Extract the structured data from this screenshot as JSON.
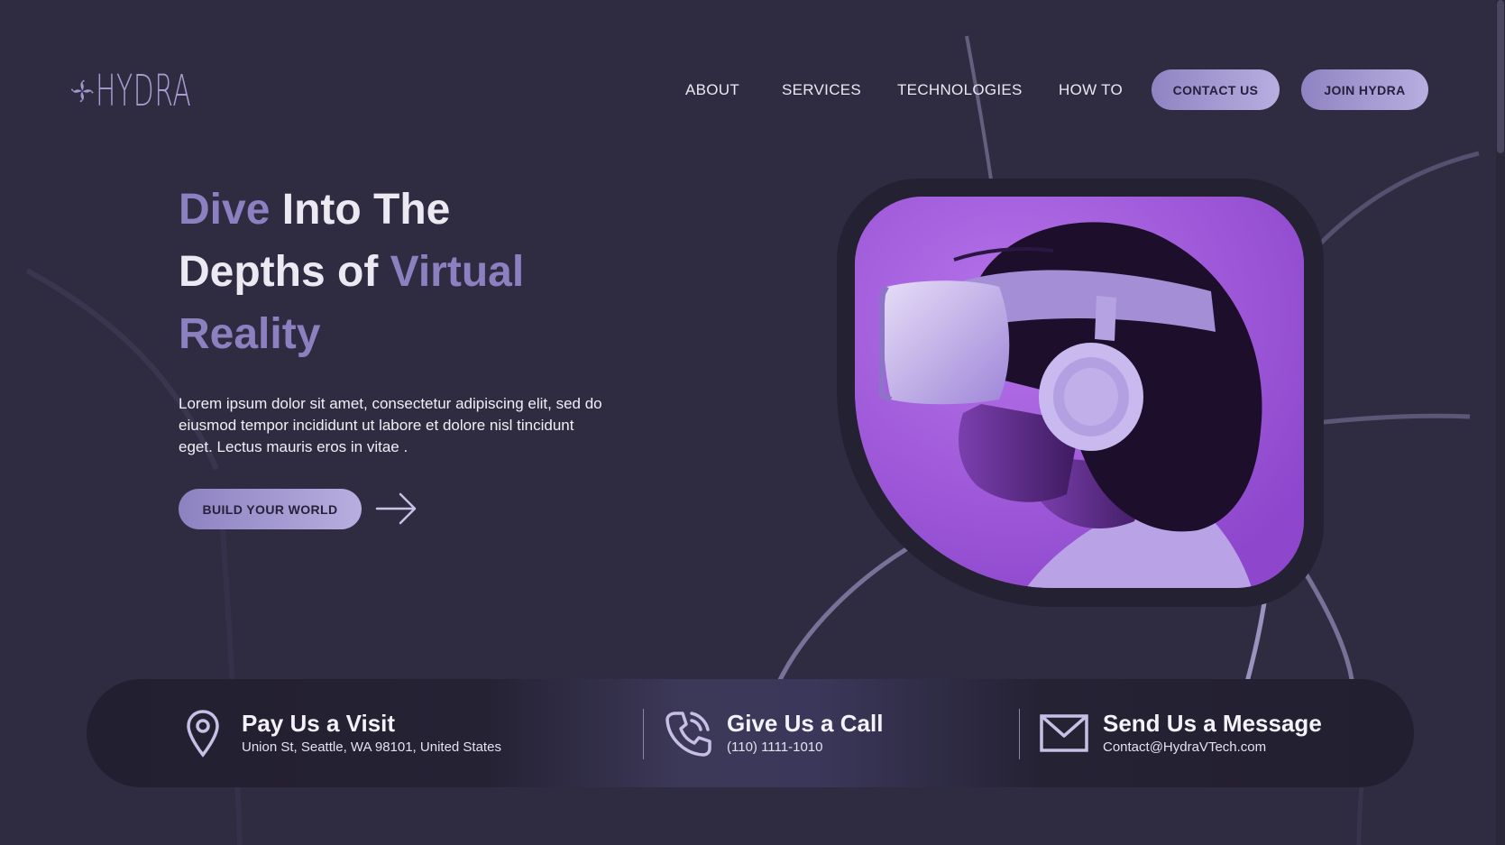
{
  "brand": {
    "name": "HYDRA",
    "logo_icon": "hydra-swirl-icon"
  },
  "nav": {
    "items": [
      "ABOUT",
      "SERVICES",
      "TECHNOLOGIES",
      "HOW TO"
    ],
    "contact_label": "CONTACT US",
    "join_label": "JOIN HYDRA"
  },
  "hero": {
    "title_parts": [
      "Dive",
      " Into The",
      "Depths of",
      " Virtual",
      "Reality"
    ],
    "text": "Lorem ipsum dolor sit amet, consectetur adipiscing elit, sed do eiusmod tempor incididunt ut labore et dolore nisl tincidunt eget. Lectus mauris eros in vitae .",
    "cta_label": "BUILD YOUR WORLD",
    "arrow_icon": "arrow-right-icon",
    "image": "vr-headset-person-photo"
  },
  "contact": [
    {
      "icon": "map-pin-icon",
      "title": "Pay Us a Visit",
      "subtitle": "Union St, Seattle, WA 98101, United States"
    },
    {
      "icon": "phone-icon",
      "title": "Give Us a Call",
      "subtitle": "(110) 1111-1010"
    },
    {
      "icon": "envelope-icon",
      "title": "Send Us a Message",
      "subtitle": "Contact@HydraVTech.com"
    }
  ],
  "colors": {
    "background": "#2f2c41",
    "accent": "#8d80c0",
    "pill": "#a79bd0",
    "image_purple": "#9b56d8"
  }
}
